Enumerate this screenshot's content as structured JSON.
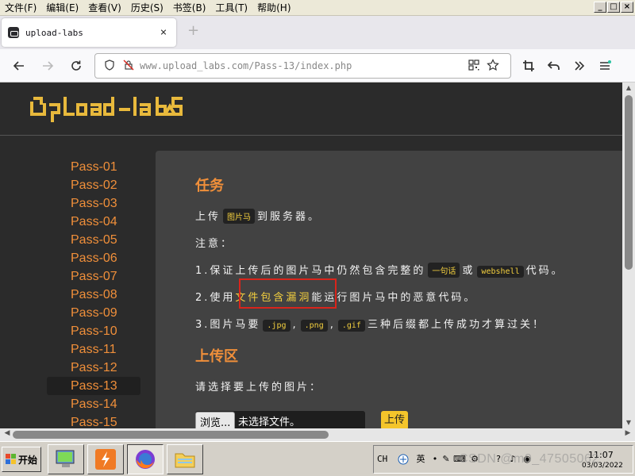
{
  "menubar": {
    "items": [
      "文件(F)",
      "编辑(E)",
      "查看(V)",
      "历史(S)",
      "书签(B)",
      "工具(T)",
      "帮助(H)"
    ],
    "window_controls": [
      "_",
      "□",
      "×"
    ]
  },
  "tab": {
    "title": "upload-labs",
    "close": "×",
    "new_tab": "+"
  },
  "nav": {
    "url_host": "www.upload_labs.com",
    "url_path": "/Pass-13/index.php"
  },
  "site": {
    "logo_text": "UpLoad-laBS"
  },
  "sidebar": {
    "passes": [
      "Pass-01",
      "Pass-02",
      "Pass-03",
      "Pass-04",
      "Pass-05",
      "Pass-06",
      "Pass-07",
      "Pass-08",
      "Pass-09",
      "Pass-10",
      "Pass-11",
      "Pass-12",
      "Pass-13",
      "Pass-14",
      "Pass-15"
    ],
    "active": "Pass-13"
  },
  "task": {
    "heading": "任务",
    "line1_pre": "上传",
    "line1_code": "图片马",
    "line1_post": "到服务器。",
    "note": "注意：",
    "item1_pre": "1.保证上传后的图片马中仍然包含完整的",
    "item1_code1": "一句话",
    "item1_mid": "或",
    "item1_code2": "webshell",
    "item1_post": "代码。",
    "item2_pre": "2.使用",
    "item2_hl": "文件包含漏洞",
    "item2_post": "能运行图片马中的恶意代码。",
    "item3_pre": "3.图片马要",
    "item3_code1": ".jpg",
    "item3_sep1": ",",
    "item3_code2": ".png",
    "item3_sep2": ",",
    "item3_code3": ".gif",
    "item3_post": "三种后缀都上传成功才算过关！"
  },
  "upload": {
    "heading": "上传区",
    "prompt": "请选择要上传的图片：",
    "browse_label": "浏览...",
    "no_file": "未选择文件。",
    "submit_label": "上传"
  },
  "taskbar": {
    "start_label": "开始",
    "lang": "CH",
    "time": "11:07",
    "date": "03/03/2022"
  },
  "watermark": "CSDN @m0_47505062"
}
